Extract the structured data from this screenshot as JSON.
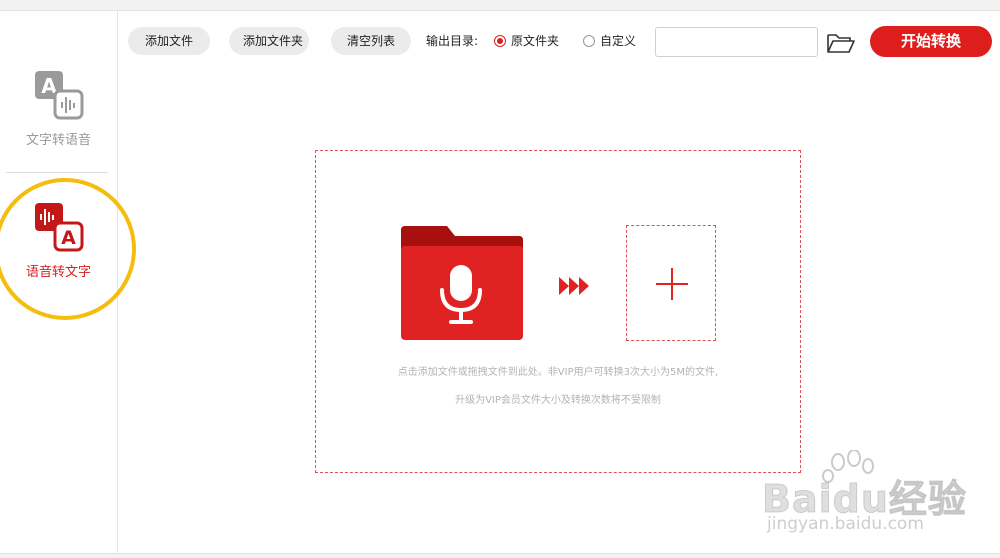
{
  "sidebar": {
    "items": [
      {
        "label": "文字转语音",
        "icon": "text-to-speech-icon",
        "active": false
      },
      {
        "label": "语音转文字",
        "icon": "speech-to-text-icon",
        "active": true
      }
    ]
  },
  "toolbar": {
    "add_file_label": "添加文件",
    "add_folder_label": "添加文件夹",
    "clear_list_label": "清空列表",
    "output_dir_label": "输出目录:",
    "radio_original_label": "原文件夹",
    "radio_custom_label": "自定义",
    "selected_output": "原文件夹",
    "path_value": "",
    "path_placeholder": "",
    "folder_icon": "folder-open-icon",
    "start_label": "开始转换"
  },
  "dropzone": {
    "hint_line1": "点击添加文件或拖拽文件到此处。非VIP用户可转换3次大小为5M的文件,",
    "hint_line2": "升级为VIP会员文件大小及转换次数将不受限制",
    "folder_icon": "microphone-folder-icon",
    "arrow_icon": "triple-arrow-icon",
    "add_icon": "plus-icon"
  },
  "watermark": {
    "brand": "Baidu经验",
    "url": "jingyan.baidu.com"
  },
  "colors": {
    "accent": "#de1d1d",
    "highlight": "#f5bd0d",
    "muted_text": "#b3b3b3",
    "button_bg": "#ebebeb"
  }
}
